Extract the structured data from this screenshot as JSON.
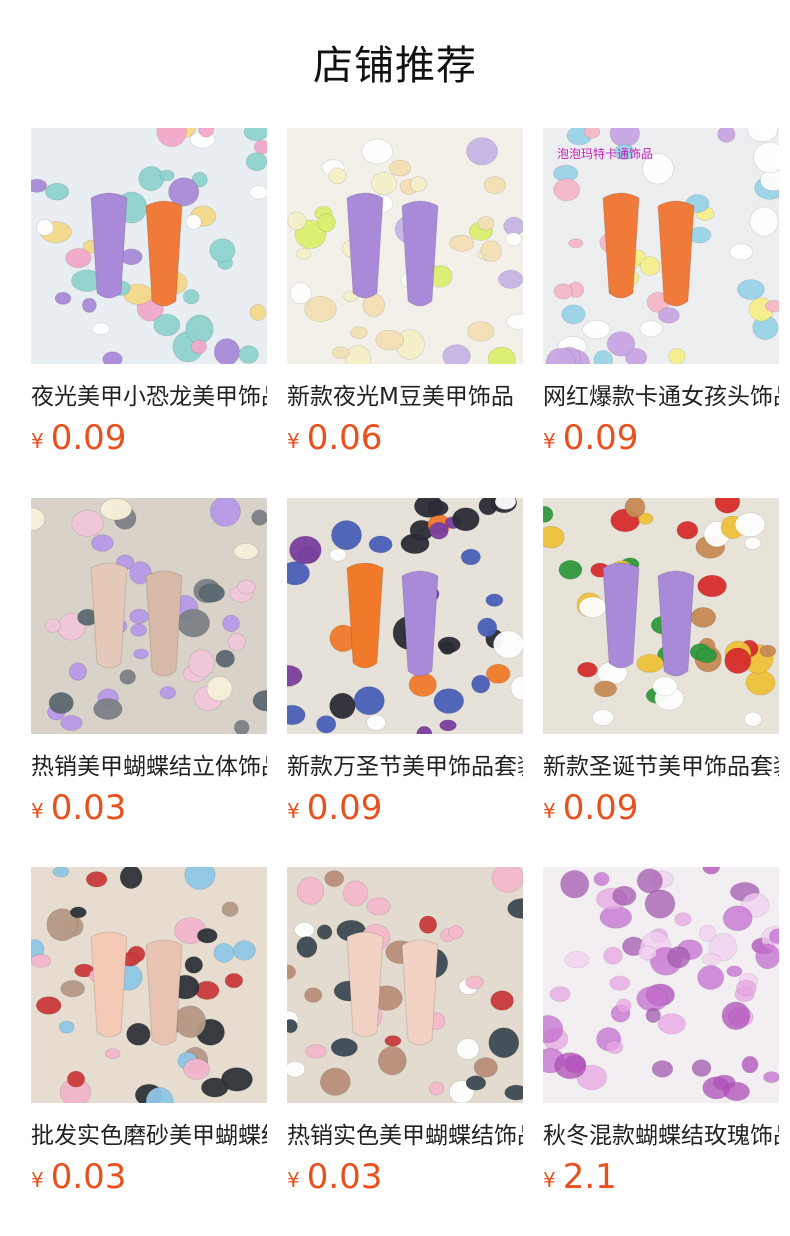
{
  "header": {
    "title": "店铺推荐"
  },
  "products": [
    {
      "title": "夜光美甲小恐龙美甲饰品",
      "currency": "¥",
      "price": "0.09",
      "image": "dinosaur-nail-charms",
      "bg": "#e9eef2",
      "palette": [
        "#f3a9c9",
        "#a98ad8",
        "#8fd3cf",
        "#f4d98a",
        "#ffffff"
      ],
      "nails": [
        "#a98ad8",
        "#f07a3a"
      ]
    },
    {
      "title": "新款夜光M豆美甲饰品",
      "currency": "¥",
      "price": "0.06",
      "image": "m-candy-nail-charms",
      "bg": "#f3f0ea",
      "palette": [
        "#d9ef6e",
        "#f4e0b5",
        "#c7b6e6",
        "#ffffff",
        "#f5f0c8"
      ],
      "nails": [
        "#a98ad8",
        "#a98ad8"
      ]
    },
    {
      "title": "网红爆款卡通女孩头饰品",
      "currency": "¥",
      "price": "0.09",
      "image": "cartoon-girl-nail-charms",
      "bg": "#eceef0",
      "palette": [
        "#f6f08a",
        "#c9a6e4",
        "#f5b8c9",
        "#9ad3e8",
        "#ffffff"
      ],
      "nails": [
        "#f07a3a",
        "#f07a3a"
      ],
      "watermark": "泡泡玛特卡通饰品"
    },
    {
      "title": "热销美甲蝴蝶结立体饰品",
      "currency": "¥",
      "price": "0.03",
      "image": "bow-nail-charms",
      "bg": "#d8d2c8",
      "palette": [
        "#b79ae8",
        "#7d8186",
        "#f1c7d9",
        "#f7f0da",
        "#5c6870"
      ],
      "nails": [
        "#e4c9b8",
        "#d6b9a6"
      ]
    },
    {
      "title": "新款万圣节美甲饰品套装",
      "currency": "¥",
      "price": "0.09",
      "image": "halloween-nail-charms",
      "bg": "#e7e2d9",
      "palette": [
        "#f07a2a",
        "#2c2c36",
        "#ffffff",
        "#4a5fb8",
        "#7b3f9e"
      ],
      "nails": [
        "#f07a2a",
        "#a98ad8"
      ]
    },
    {
      "title": "新款圣诞节美甲饰品套装",
      "currency": "¥",
      "price": "0.09",
      "image": "christmas-nail-charms",
      "bg": "#e8e3d8",
      "palette": [
        "#d62d2d",
        "#2f9a3e",
        "#ffffff",
        "#c78a55",
        "#f0c23a"
      ],
      "nails": [
        "#a98ad8",
        "#a98ad8"
      ]
    },
    {
      "title": "批发实色磨砂美甲蝴蝶结",
      "currency": "¥",
      "price": "0.03",
      "image": "matte-bow-nail-charms",
      "bg": "#e6ddd0",
      "palette": [
        "#c93a3a",
        "#2f3338",
        "#f2b6cc",
        "#8fc7e6",
        "#b59a86"
      ],
      "nails": [
        "#f4c9b6",
        "#e9c3b1"
      ]
    },
    {
      "title": "热销实色美甲蝴蝶结饰品",
      "currency": "¥",
      "price": "0.03",
      "image": "solid-bow-nail-charms",
      "bg": "#e3dbcf",
      "palette": [
        "#c93a3a",
        "#3d4952",
        "#f4b9cc",
        "#b98f7a",
        "#ffffff"
      ],
      "nails": [
        "#f2d2c2",
        "#f2d2c2"
      ]
    },
    {
      "title": "秋冬混款蝴蝶结玫瑰饰品",
      "currency": "¥",
      "price": "2.1",
      "image": "glitter-bow-charms",
      "bg": "#f2eef2",
      "palette": [
        "#c46fd0",
        "#e7a6e3",
        "#b04fb8",
        "#f3d0f0",
        "#a35ab0"
      ],
      "nails": []
    }
  ]
}
